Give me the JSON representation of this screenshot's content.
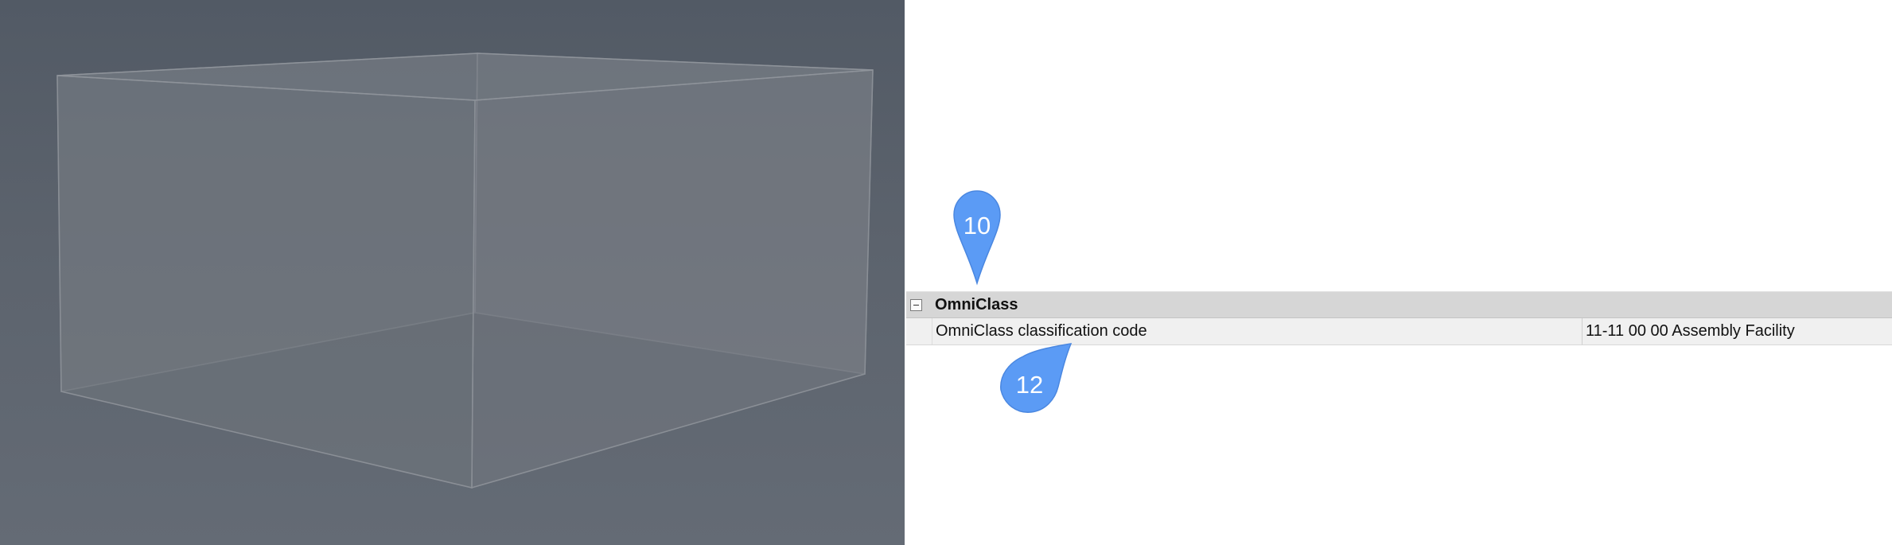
{
  "property_grid": {
    "category": {
      "label": "OmniClass",
      "expanded": true
    },
    "rows": [
      {
        "name": "OmniClass classification code",
        "value": "11-11 00 00 Assembly Facility"
      }
    ]
  },
  "callouts": [
    {
      "number": "10",
      "color": "#5b9bf5"
    },
    {
      "number": "12",
      "color": "#5b9bf5"
    }
  ],
  "viewport": {
    "background": "#5c636d",
    "object": "transparent-box"
  }
}
